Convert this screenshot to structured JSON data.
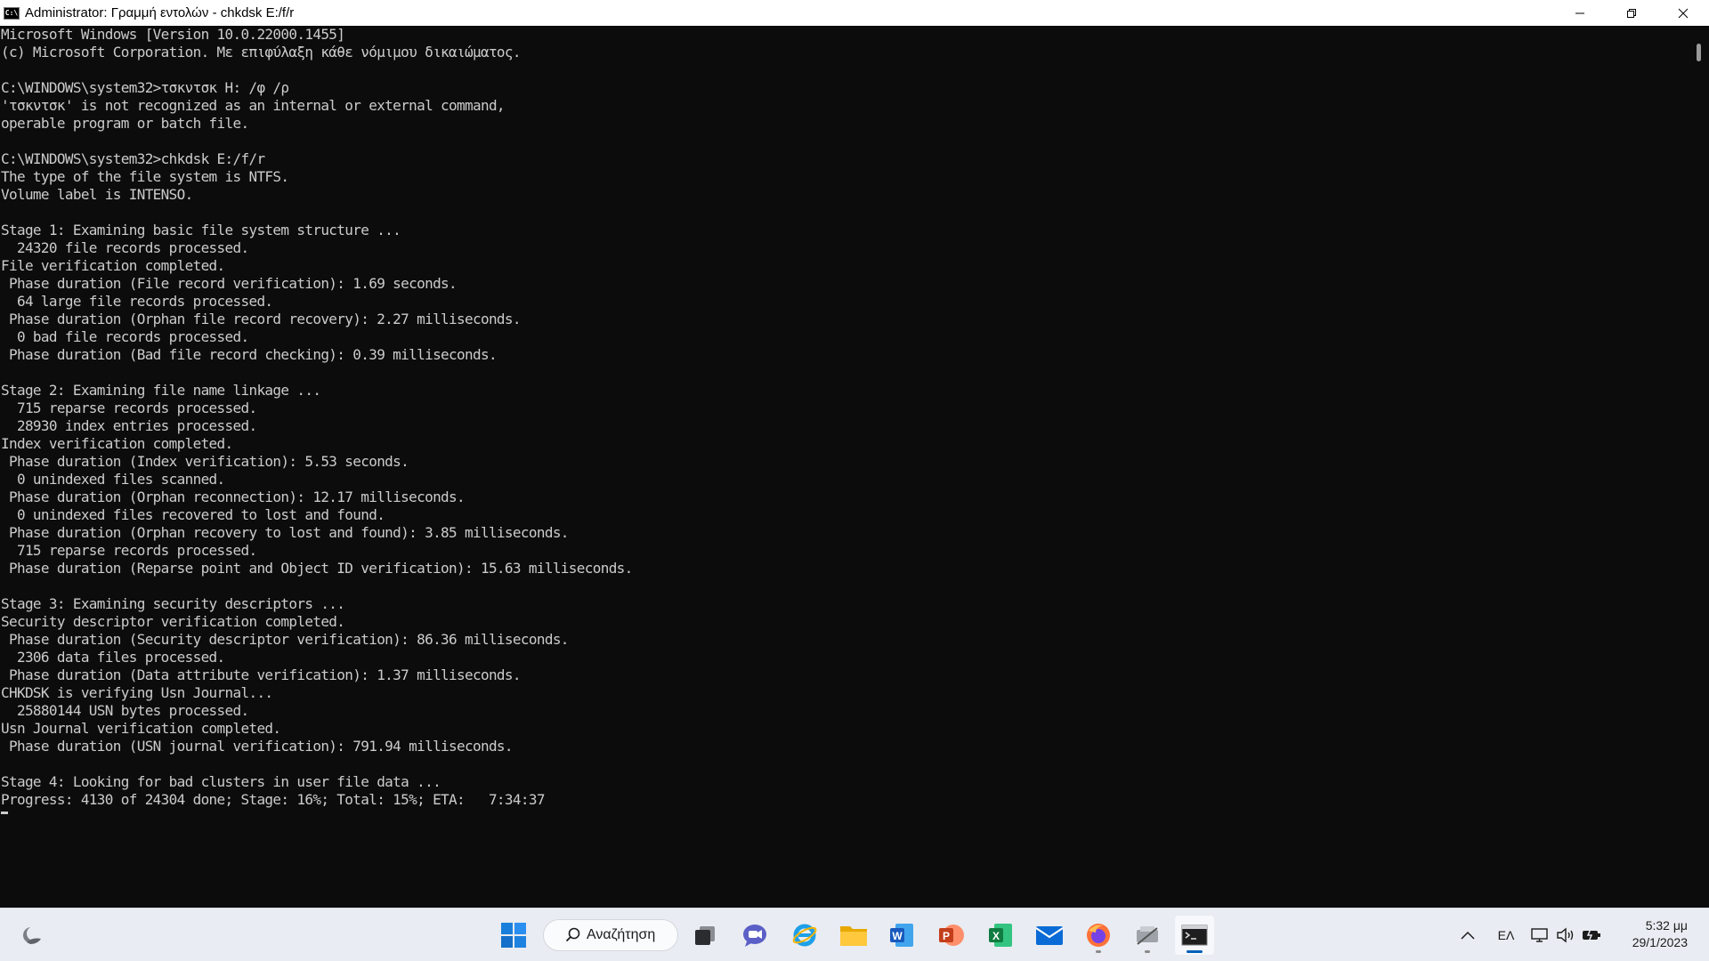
{
  "window": {
    "title": "Administrator: Γραμμή εντολών - chkdsk  E:/f/r",
    "icon_label": "C:\\",
    "controls": [
      "minimize-icon",
      "restore-icon",
      "close-icon"
    ]
  },
  "console": {
    "text": "Microsoft Windows [Version 10.0.22000.1455]\n(c) Microsoft Corporation. Με επιφύλαξη κάθε νόμιμου δικαιώματος.\n\nC:\\WINDOWS\\system32>τσκντσκ Η: /φ /ρ\n'τσκντσκ' is not recognized as an internal or external command,\noperable program or batch file.\n\nC:\\WINDOWS\\system32>chkdsk E:/f/r\nThe type of the file system is NTFS.\nVolume label is INTENSO.\n\nStage 1: Examining basic file system structure ...\n  24320 file records processed.\nFile verification completed.\n Phase duration (File record verification): 1.69 seconds.\n  64 large file records processed.\n Phase duration (Orphan file record recovery): 2.27 milliseconds.\n  0 bad file records processed.\n Phase duration (Bad file record checking): 0.39 milliseconds.\n\nStage 2: Examining file name linkage ...\n  715 reparse records processed.\n  28930 index entries processed.\nIndex verification completed.\n Phase duration (Index verification): 5.53 seconds.\n  0 unindexed files scanned.\n Phase duration (Orphan reconnection): 12.17 milliseconds.\n  0 unindexed files recovered to lost and found.\n Phase duration (Orphan recovery to lost and found): 3.85 milliseconds.\n  715 reparse records processed.\n Phase duration (Reparse point and Object ID verification): 15.63 milliseconds.\n\nStage 3: Examining security descriptors ...\nSecurity descriptor verification completed.\n Phase duration (Security descriptor verification): 86.36 milliseconds.\n  2306 data files processed.\n Phase duration (Data attribute verification): 1.37 milliseconds.\nCHKDSK is verifying Usn Journal...\n  25880144 USN bytes processed.\nUsn Journal verification completed.\n Phase duration (USN journal verification): 791.94 milliseconds.\n\nStage 4: Looking for bad clusters in user file data ...\nProgress: 4130 of 24304 done; Stage: 16%; Total: 15%; ETA:   7:34:37"
  },
  "taskbar": {
    "search_label": "Αναζήτηση",
    "language": "ΕΛ",
    "time": "5:32 μμ",
    "date": "29/1/2023",
    "pinned": [
      "windows-start",
      "task-view",
      "chat",
      "internet-explorer",
      "file-explorer",
      "word",
      "powerpoint",
      "excel",
      "mail",
      "firefox",
      "snipping-tool",
      "command-prompt"
    ]
  }
}
